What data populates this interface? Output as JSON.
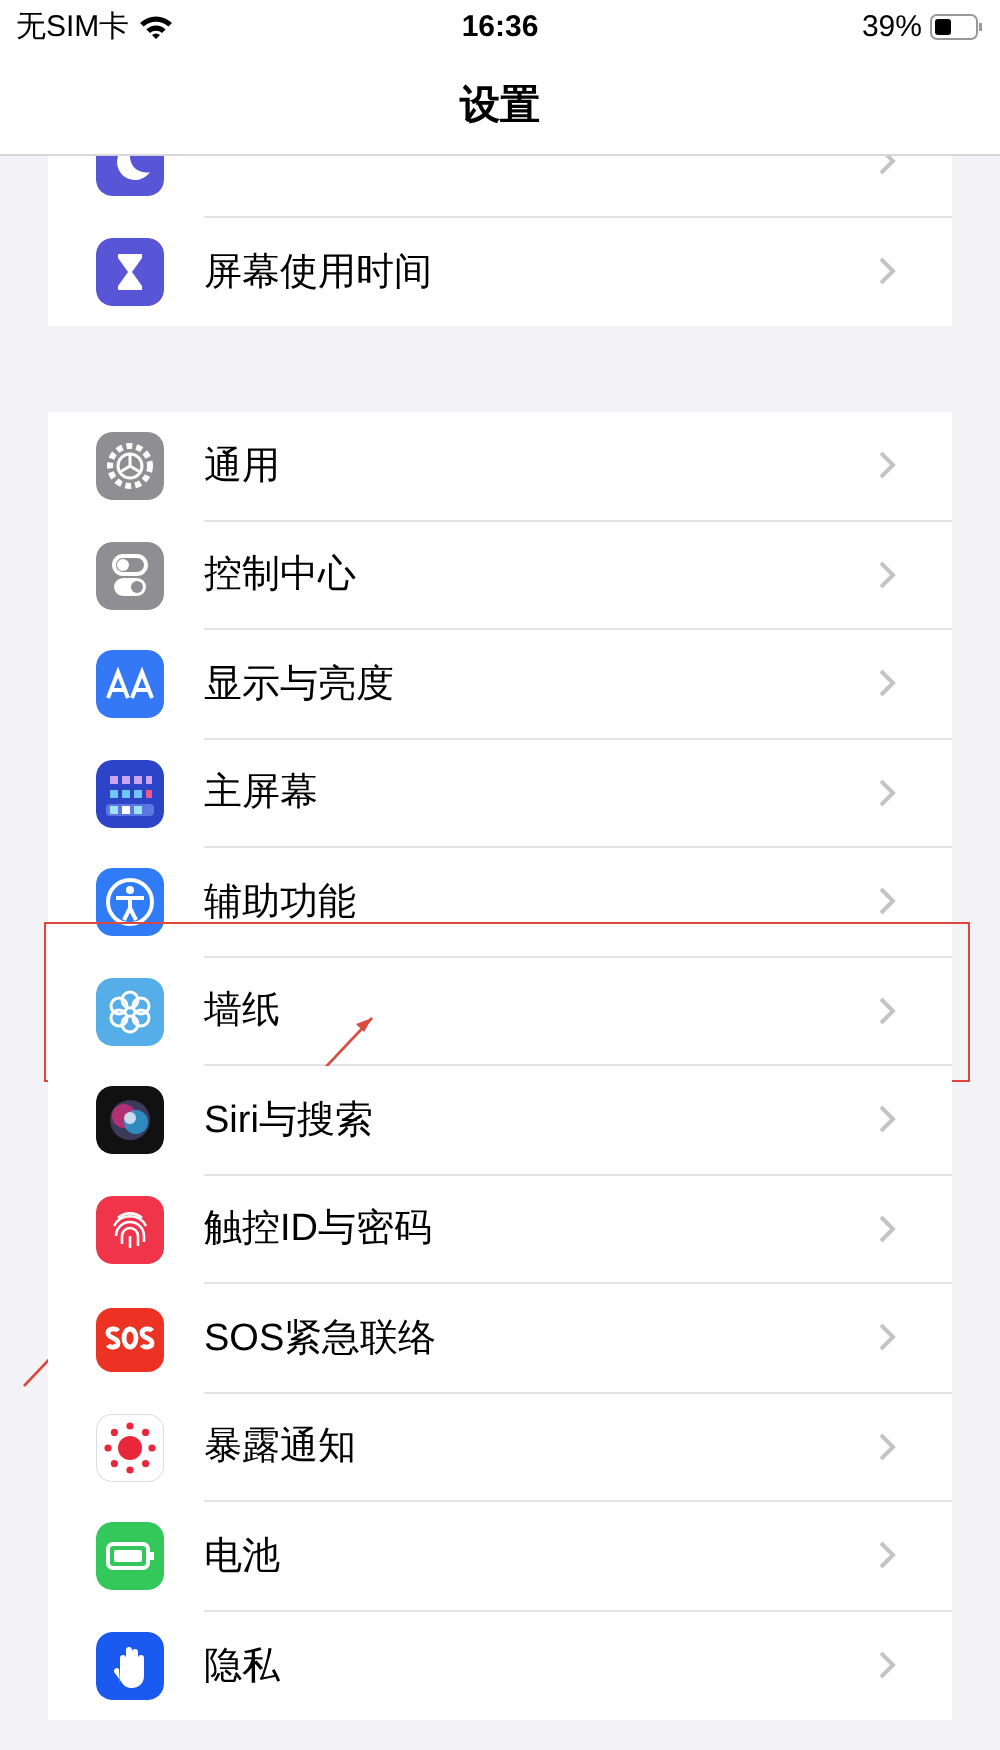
{
  "status_bar": {
    "carrier": "无SIM卡",
    "time": "16:36",
    "battery": "39%"
  },
  "title": "设置",
  "groups": [
    {
      "items": [
        {
          "kind": "moon",
          "highlighted": false
        },
        {
          "kind": "hourglass",
          "label": "屏幕使用时间",
          "highlighted": false
        }
      ]
    },
    {
      "items": [
        {
          "kind": "gear",
          "label": "通用",
          "highlighted": false
        },
        {
          "kind": "toggles",
          "label": "控制中心",
          "highlighted": false
        },
        {
          "kind": "display",
          "label": "显示与亮度",
          "highlighted": false
        },
        {
          "kind": "home",
          "label": "主屏幕",
          "highlighted": false
        },
        {
          "kind": "accessibility",
          "label": "辅助功能",
          "highlighted": false
        },
        {
          "kind": "wallpaper",
          "label": "墙纸",
          "highlighted": true
        },
        {
          "kind": "siri",
          "label": "Siri与搜索",
          "highlighted": false
        },
        {
          "kind": "touchid",
          "label": "触控ID与密码",
          "highlighted": false
        },
        {
          "kind": "sos",
          "label": "SOS紧急联络",
          "highlighted": false
        },
        {
          "kind": "exposure",
          "label": "暴露通知",
          "highlighted": false
        },
        {
          "kind": "battery",
          "label": "电池",
          "highlighted": false
        },
        {
          "kind": "privacy",
          "label": "隐私",
          "highlighted": false
        }
      ]
    }
  ]
}
